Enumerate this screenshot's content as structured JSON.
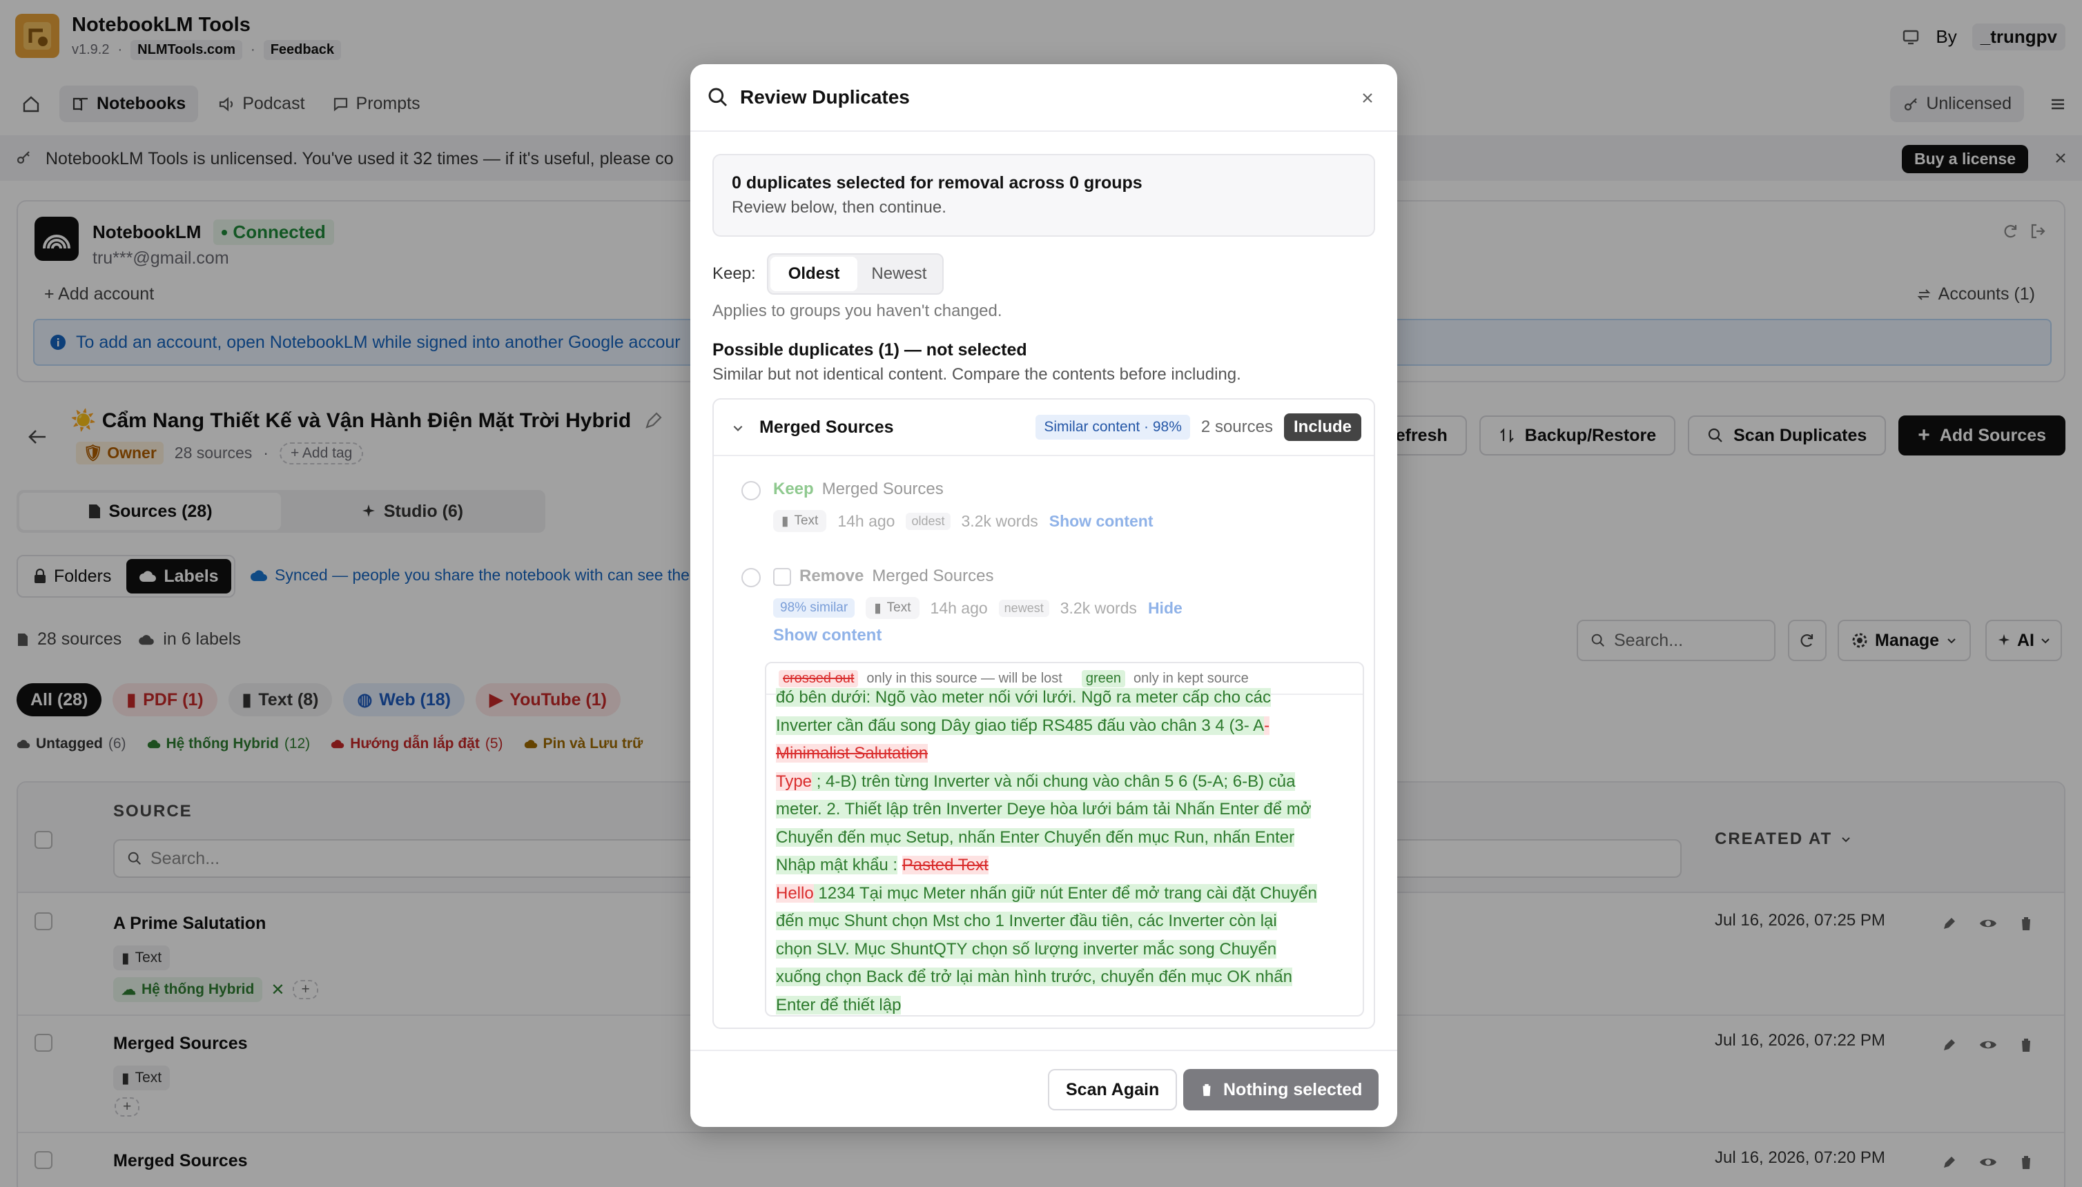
{
  "app": {
    "name": "NotebookLM Tools",
    "version": "v1.9.2",
    "site": "NLMTools.com",
    "feedback": "Feedback",
    "by_label": "By",
    "author": "_trungpv",
    "brand_color": "#e8a23a"
  },
  "nav": {
    "notebooks": "Notebooks",
    "podcast": "Podcast",
    "prompts": "Prompts",
    "unlicensed": "Unlicensed"
  },
  "banner": {
    "text": "NotebookLM Tools is unlicensed. You've used it 32 times — if it's useful, please co",
    "buy": "Buy a license"
  },
  "account": {
    "name": "NotebookLM",
    "status": "Connected",
    "email": "tru***@gmail.com",
    "add_account": "+ Add account",
    "accounts": "Accounts (1)",
    "info": "To add an account, open NotebookLM while signed into another Google accour"
  },
  "notebook": {
    "title": "☀️ Cẩm Nang Thiết Kế và Vận Hành Điện Mặt Trời Hybrid",
    "owner": "Owner",
    "sources_count": "28 sources",
    "add_tag": "+ Add tag",
    "refresh": "Refresh",
    "backup": "Backup/Restore",
    "scan": "Scan Duplicates",
    "add_sources": "Add Sources"
  },
  "tabs": {
    "sources": "Sources (28)",
    "studio": "Studio (6)"
  },
  "toggle": {
    "folders": "Folders",
    "labels": "Labels",
    "synced": "Synced — people you share the notebook with can see the"
  },
  "summary": {
    "sources": "28 sources",
    "labels": "in 6 labels",
    "search_placeholder": "Search...",
    "manage": "Manage",
    "ai": "AI"
  },
  "filters": [
    {
      "label": "All (28)"
    },
    {
      "label": "PDF (1)"
    },
    {
      "label": "Text (8)"
    },
    {
      "label": "Web (18)"
    },
    {
      "label": "YouTube (1)"
    }
  ],
  "label_chips": [
    {
      "name": "Untagged",
      "count": "(6)"
    },
    {
      "name": "Hệ thống Hybrid",
      "count": "(12)"
    },
    {
      "name": "Hướng dẫn lắp đặt",
      "count": "(5)"
    },
    {
      "name": "Pin và Lưu trữ",
      "count": ""
    }
  ],
  "table": {
    "col_source": "SOURCE",
    "col_created": "CREATED AT",
    "search_placeholder": "Search...",
    "rows": [
      {
        "title": "A Prime Salutation",
        "type": "Text",
        "tag": "Hệ thống Hybrid",
        "date": "Jul 16, 2026, 07:25 PM"
      },
      {
        "title": "Merged Sources",
        "type": "Text",
        "tag": "",
        "date": "Jul 16, 2026, 07:22 PM"
      },
      {
        "title": "Merged Sources",
        "type": "Text",
        "tag": "",
        "date": "Jul 16, 2026, 07:20 PM"
      }
    ]
  },
  "modal": {
    "title": "Review Duplicates",
    "summary_title": "0 duplicates selected for removal across 0 groups",
    "summary_sub": "Review below, then continue.",
    "keep_label": "Keep:",
    "keep_oldest": "Oldest",
    "keep_newest": "Newest",
    "keep_hint": "Applies to groups you haven't changed.",
    "possible_title": "Possible duplicates (1) — not selected",
    "possible_sub": "Similar but not identical content. Compare the contents before including.",
    "group": {
      "name": "Merged Sources",
      "similar": "Similar content · 98%",
      "count": "2 sources",
      "include": "Include",
      "keep_item": {
        "action": "Keep",
        "name": "Merged Sources",
        "type": "Text",
        "age": "14h ago",
        "badge": "oldest",
        "words": "3.2k words",
        "toggle": "Show content"
      },
      "remove_item": {
        "action": "Remove",
        "name": "Merged Sources",
        "similar": "98% similar",
        "type": "Text",
        "age": "14h ago",
        "badge": "newest",
        "words": "3.2k words",
        "toggle": "Hide",
        "show": "Show content"
      },
      "legend": {
        "crossed": "crossed out",
        "crossed_desc": "only in this source — will be lost",
        "green": "green",
        "green_desc": "only in kept source"
      },
      "diff": {
        "l1": "đó bên dưới: Ngõ vào meter nối với lưới. Ngõ ra meter cấp cho các",
        "l2": "Inverter cần đấu song Dây giao tiếp RS485 đấu vào chân 3 4 (3- A",
        "l2r": "-",
        "l3r": "Minimalist Salutation",
        "l4r": "Type",
        "l4": " ; 4-B) trên từng Inverter và nối chung vào chân 5 6 (5-A; 6-B) của",
        "l5": "meter. 2. Thiết lập trên Inverter Deye hòa lưới bám tải Nhấn Enter để mở",
        "l6": "Chuyển đến mục Setup, nhấn Enter Chuyển đến mục Run, nhấn Enter",
        "l7": "Nhập mật khẩu :",
        "l7r": "Pasted Text",
        "l8r": "Hello",
        "l8": " 1234 Tại mục Meter nhấn giữ nút Enter để mở trang cài đặt Chuyển",
        "l9": "đến mục Shunt chọn Mst cho 1 Inverter đầu tiên, các Inverter còn lại",
        "l10": "chọn SLV. Mục ShuntQTY chọn số lượng inverter mắc song Chuyển",
        "l11": "xuống chọn Back để trở lại màn hình trước, chuyển đến mục OK nhấn",
        "l12": "Enter để thiết lập"
      }
    },
    "scan_again": "Scan Again",
    "nothing_selected": "Nothing selected"
  }
}
